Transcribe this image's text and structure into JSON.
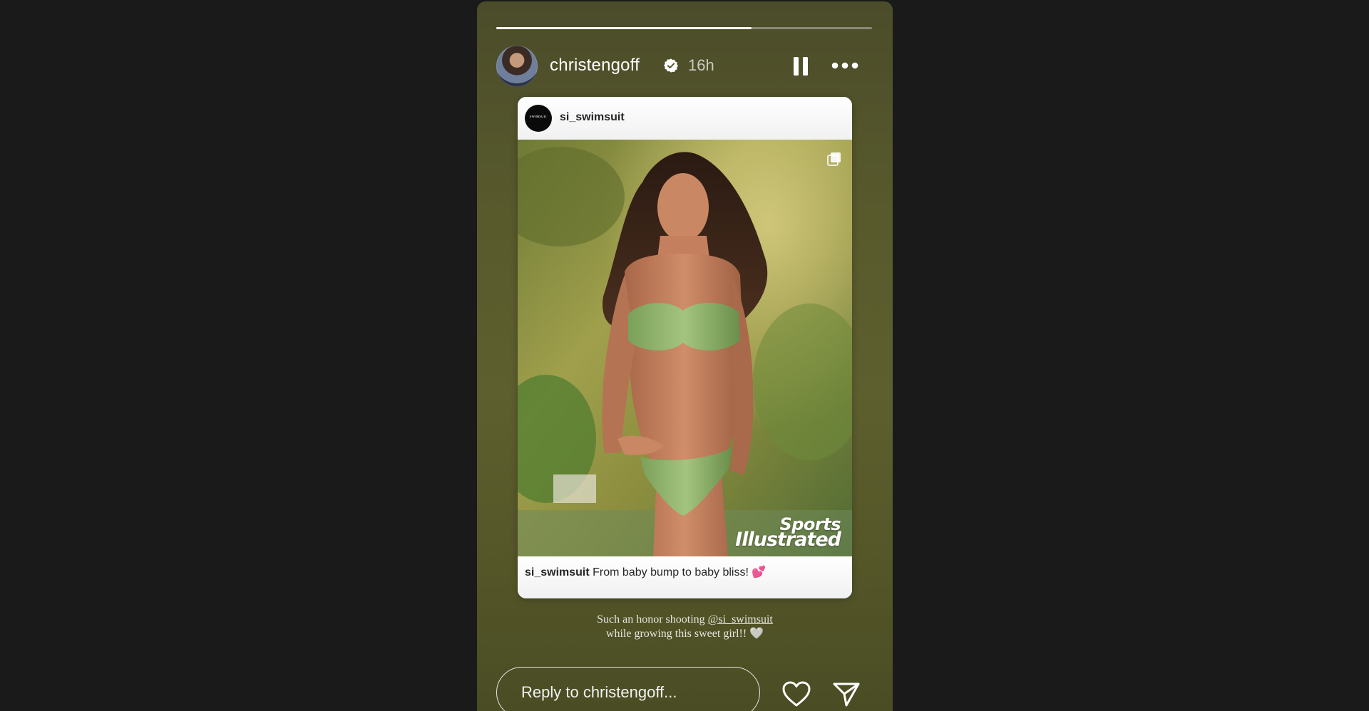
{
  "story": {
    "progress": 0.68,
    "username": "christengoff",
    "verified": true,
    "time_ago": "16h",
    "icons": {
      "avatar": "profile-avatar",
      "verified": "verified-badge-icon",
      "pause": "pause-icon",
      "more": "more-icon"
    }
  },
  "post": {
    "username": "si_swimsuit",
    "avatar_text": "SWIMSUIT",
    "watermark_line1": "Sports",
    "watermark_line2": "Illustrated",
    "caption_user": "si_swimsuit",
    "caption_text": "From baby bump to baby bliss!",
    "caption_emoji": "💕",
    "icons": {
      "multi": "multiple-images-icon"
    }
  },
  "story_caption": {
    "prefix": "Such an honor shooting ",
    "mention": "@si_swimsuit",
    "line2": "while growing this sweet girl!!",
    "emoji": "🤍"
  },
  "reply": {
    "placeholder": "Reply to christengoff...",
    "value": ""
  },
  "actions": {
    "like_icon": "heart-icon",
    "send_icon": "send-icon"
  },
  "colors": {
    "page_bg": "#1a1a1a",
    "story_bg": "#585a2c",
    "accent_heart": "#d6449a"
  }
}
